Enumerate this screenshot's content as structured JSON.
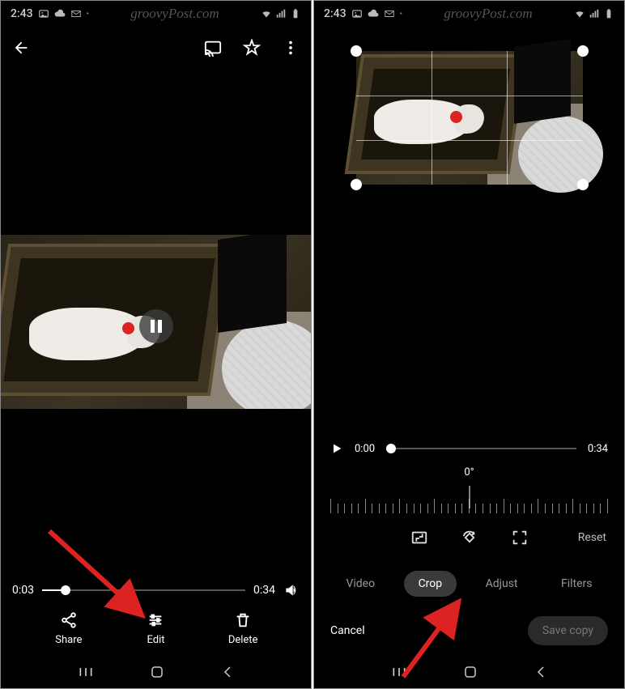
{
  "status": {
    "time": "2:43",
    "watermark": "groovyPost.com"
  },
  "viewer": {
    "currentTime": "0:03",
    "duration": "0:34",
    "progressPercent": 9,
    "actions": {
      "share": "Share",
      "edit": "Edit",
      "delete": "Delete"
    }
  },
  "editor": {
    "currentTime": "0:00",
    "duration": "0:34",
    "progressPercent": 0,
    "angle": "0°",
    "tabs": {
      "video": "Video",
      "crop": "Crop",
      "adjust": "Adjust",
      "filters": "Filters"
    },
    "reset": "Reset",
    "cancel": "Cancel",
    "saveCopy": "Save copy"
  }
}
